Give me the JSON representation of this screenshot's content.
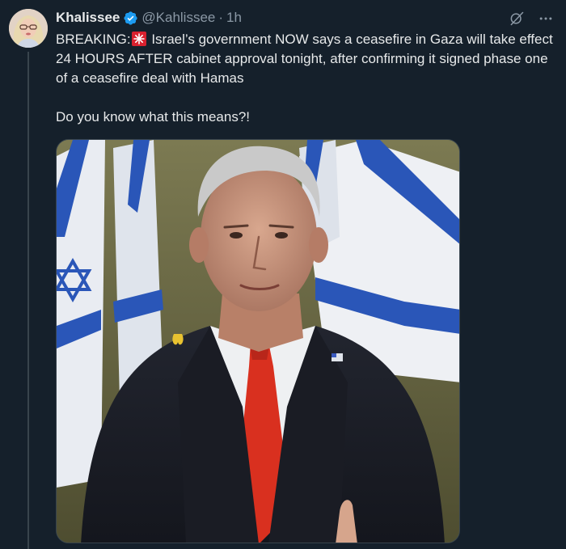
{
  "tweet": {
    "author": {
      "display_name": "Khalissee",
      "handle": "@Kahlissee",
      "verified": true,
      "avatar_icon": "avatar"
    },
    "separator": "·",
    "time": "1h",
    "text_parts": {
      "lead": "BREAKING:",
      "emoji_icon": "rotating-light",
      "rest": " Israel’s government NOW says a ceasefire in Gaza will take effect 24 HOURS AFTER cabinet approval tonight, after confirming it signed phase one of a ceasefire deal with Hamas"
    },
    "question": "Do you know what this means?!",
    "header_icons": [
      "grok-icon",
      "more-icon"
    ],
    "media": {
      "type": "photo",
      "icon": "photo"
    }
  },
  "colors": {
    "background": "#15202b",
    "text": "#e7e9ea",
    "muted": "#8b98a5",
    "verified": "#1d9bf0",
    "border": "#38444d"
  }
}
